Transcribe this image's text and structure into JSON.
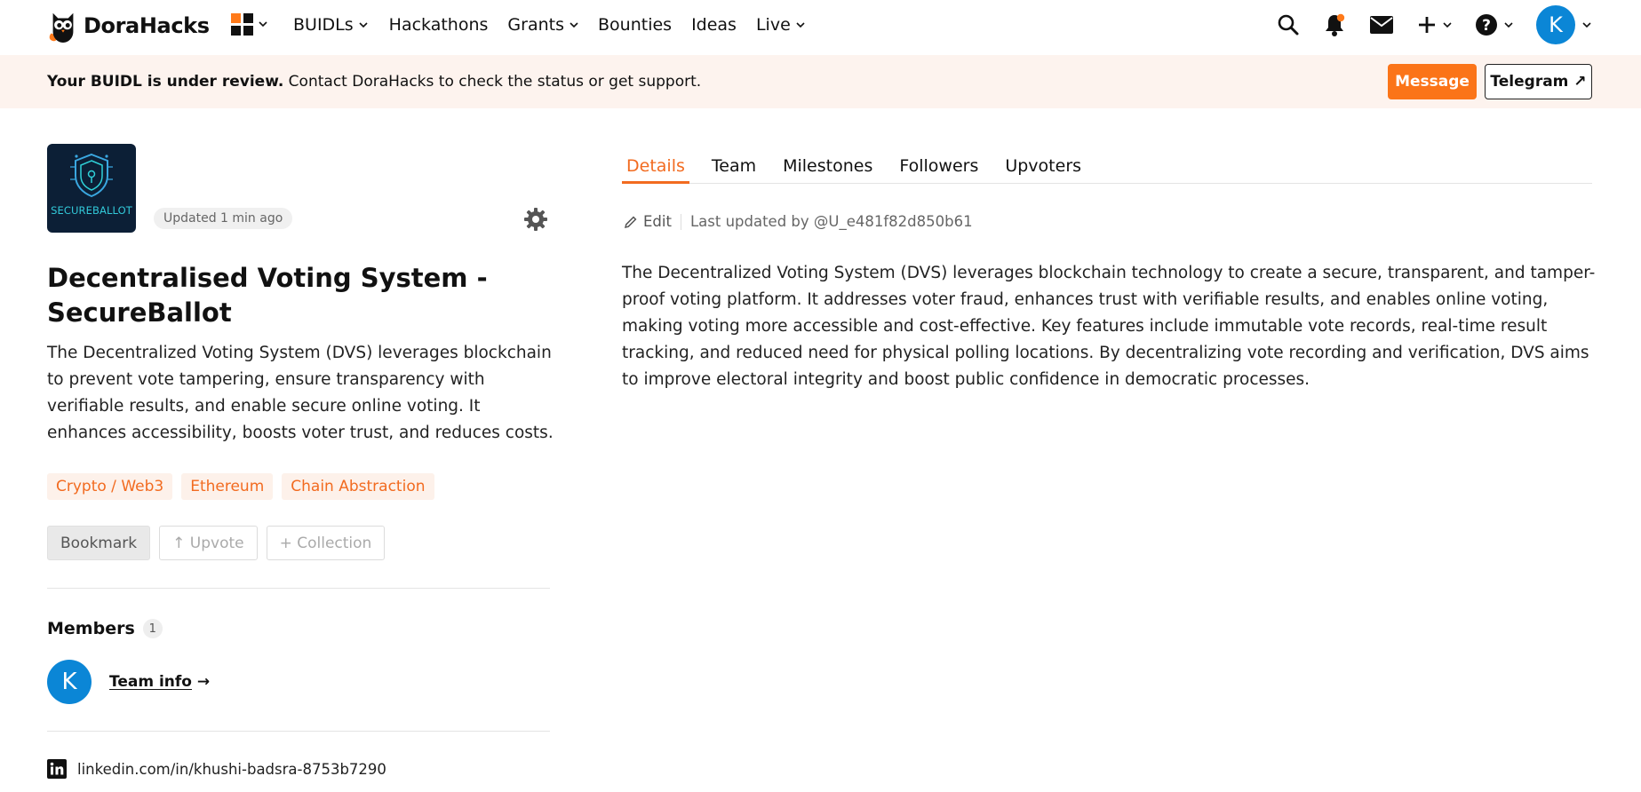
{
  "brand": {
    "name": "DoraHacks",
    "accent": "#f26b20"
  },
  "nav": {
    "items": [
      {
        "label": "BUIDLs",
        "dropdown": true
      },
      {
        "label": "Hackathons",
        "dropdown": false
      },
      {
        "label": "Grants",
        "dropdown": true
      },
      {
        "label": "Bounties",
        "dropdown": false
      },
      {
        "label": "Ideas",
        "dropdown": false
      },
      {
        "label": "Live",
        "dropdown": true
      }
    ],
    "user_initial": "K"
  },
  "banner": {
    "bold": "Your BUIDL is under review.",
    "text": " Contact DoraHacks to check the status or get support.",
    "message_label": "Message",
    "telegram_label": "Telegram ↗"
  },
  "project": {
    "logo_word": "SECUREBALLOT",
    "updated": "Updated 1 min ago",
    "title": "Decentralised Voting System - SecureBallot",
    "summary": "The Decentralized Voting System (DVS) leverages blockchain to prevent vote tampering, ensure transparency with verifiable results, and enable secure online voting. It enhances accessibility, boosts voter trust, and reduces costs.",
    "tags": [
      "Crypto / Web3",
      "Ethereum",
      "Chain Abstraction"
    ],
    "actions": {
      "bookmark": "Bookmark",
      "upvote": "↑ Upvote",
      "collection": "+ Collection"
    },
    "members_label": "Members",
    "members_count": "1",
    "member_initial": "K",
    "team_info": "Team info",
    "team_info_arrow": "→",
    "linkedin": "linkedin.com/in/khushi-badsra-8753b7290"
  },
  "tabs": [
    "Details",
    "Team",
    "Milestones",
    "Followers",
    "Upvoters"
  ],
  "details": {
    "edit_label": "Edit",
    "last_updated": "Last updated by @U_e481f82d850b61",
    "body": "The Decentralized Voting System (DVS) leverages blockchain technology to create a secure, transparent, and tamper-proof voting platform. It addresses voter fraud, enhances trust with verifiable results, and enables online voting, making voting more accessible and cost-effective. Key features include immutable vote records, real-time result tracking, and reduced need for physical polling locations. By decentralizing vote recording and verification, DVS aims to improve electoral integrity and boost public confidence in democratic processes."
  }
}
